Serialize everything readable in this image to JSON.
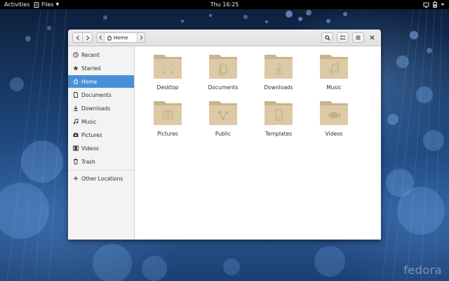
{
  "topbar": {
    "activities": "Activities",
    "app_menu": "Files",
    "clock": "Thu 16:25"
  },
  "wallpaper": {
    "logo_text": "fedora"
  },
  "window": {
    "pathbar": {
      "current": "Home"
    },
    "sidebar": {
      "items": [
        {
          "label": "Recent",
          "icon": "clock-icon"
        },
        {
          "label": "Starred",
          "icon": "star-icon"
        },
        {
          "label": "Home",
          "icon": "home-icon",
          "active": true
        },
        {
          "label": "Documents",
          "icon": "document-icon"
        },
        {
          "label": "Downloads",
          "icon": "download-icon"
        },
        {
          "label": "Music",
          "icon": "music-icon"
        },
        {
          "label": "Pictures",
          "icon": "camera-icon"
        },
        {
          "label": "Videos",
          "icon": "video-icon"
        },
        {
          "label": "Trash",
          "icon": "trash-icon"
        }
      ],
      "other_locations": "Other Locations"
    },
    "folders": [
      {
        "label": "Desktop",
        "emblem": "desktop-icon"
      },
      {
        "label": "Documents",
        "emblem": "document-icon"
      },
      {
        "label": "Downloads",
        "emblem": "download-icon"
      },
      {
        "label": "Music",
        "emblem": "music-icon"
      },
      {
        "label": "Pictures",
        "emblem": "camera-icon"
      },
      {
        "label": "Public",
        "emblem": "share-icon"
      },
      {
        "label": "Templates",
        "emblem": "template-icon"
      },
      {
        "label": "Videos",
        "emblem": "video-icon"
      }
    ]
  },
  "colors": {
    "folder": "#dcc9a5",
    "folder_tab": "#c9b48d",
    "selection": "#4a90d9",
    "topbar": "#000000"
  }
}
